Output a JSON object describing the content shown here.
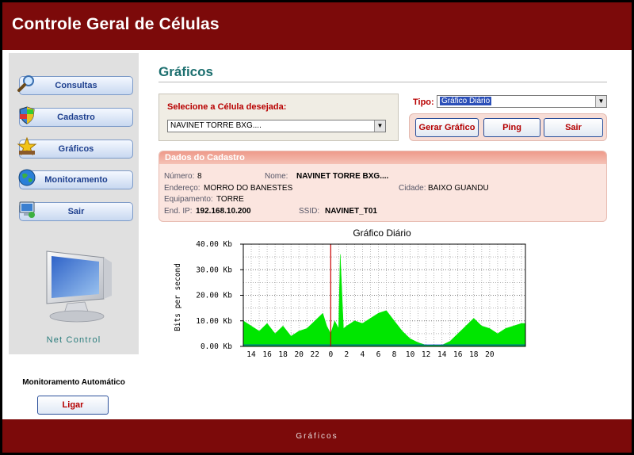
{
  "app": {
    "title": "Controle Geral de Células"
  },
  "sidebar": {
    "items": [
      {
        "label": "Consultas",
        "icon": "magnifier-icon"
      },
      {
        "label": "Cadastro",
        "icon": "shield-icon"
      },
      {
        "label": "Gráficos",
        "icon": "star-icon"
      },
      {
        "label": "Monitoramento",
        "icon": "globe-icon"
      },
      {
        "label": "Sair",
        "icon": "computer-icon"
      }
    ],
    "brand": "Net Control"
  },
  "auto_monitor": {
    "title": "Monitoramento Automático",
    "button": "Ligar"
  },
  "main": {
    "title": "Gráficos",
    "select_label": "Selecione a Célula desejada:",
    "selected_cell": "NAVINET TORRE BXG....",
    "tipo_label": "Tipo:",
    "tipo_value": "Gráfico Diário",
    "buttons": {
      "gerar": "Gerar Gráfico",
      "ping": "Ping",
      "sair": "Sair"
    }
  },
  "cadastro": {
    "header": "Dados do Cadastro",
    "numero_label": "Número:",
    "numero": "8",
    "nome_label": "Nome:",
    "nome": "NAVINET TORRE BXG....",
    "endereco_label": "Endereço:",
    "endereco": "MORRO DO BANESTES",
    "cidade_label": "Cidade:",
    "cidade": "BAIXO GUANDU",
    "equipamento_label": "Equipamento:",
    "equipamento": "TORRE",
    "ip_label": "End. IP:",
    "ip": "192.168.10.200",
    "ssid_label": "SSID:",
    "ssid": "NAVINET_T01"
  },
  "footer": {
    "label": "Gráficos"
  },
  "colors": {
    "header": "#7c0a0a",
    "fill": "#00e600",
    "marker": "#cc0000",
    "title_teal": "#1b6e6e"
  },
  "chart_data": {
    "type": "area",
    "title": "Gráfico Diário",
    "ylabel": "Bits per second",
    "ylim": [
      0,
      40
    ],
    "yticks": [
      "0.00 Kb",
      "10.00 Kb",
      "20.00 Kb",
      "30.00 Kb",
      "40.00 Kb"
    ],
    "x_ticks": [
      "14",
      "16",
      "18",
      "20",
      "22",
      "0",
      "2",
      "4",
      "6",
      "8",
      "10",
      "12",
      "14",
      "16",
      "18",
      "20"
    ],
    "marker_at": "0",
    "grid": true,
    "series": [
      {
        "color": "#00e600",
        "x_hours": [
          13.0,
          14,
          15,
          16,
          17,
          18,
          19,
          20,
          21,
          22,
          23,
          23.5,
          24,
          24.5,
          25,
          25.2,
          25.6,
          26,
          27,
          28,
          29,
          30,
          31,
          32,
          33,
          34,
          35,
          36,
          37,
          38,
          39,
          40,
          41,
          42,
          43,
          44,
          45,
          46,
          47,
          48,
          48.5
        ],
        "values": [
          10,
          8,
          6,
          9,
          5,
          8,
          4,
          6,
          7,
          10,
          13,
          8,
          5,
          10,
          7,
          36,
          7,
          8,
          10,
          9,
          11,
          13,
          14,
          10,
          6,
          3,
          1.5,
          0.5,
          0.5,
          0.5,
          2,
          5,
          8,
          11,
          8,
          7,
          5,
          7,
          8,
          9,
          9
        ]
      }
    ]
  }
}
